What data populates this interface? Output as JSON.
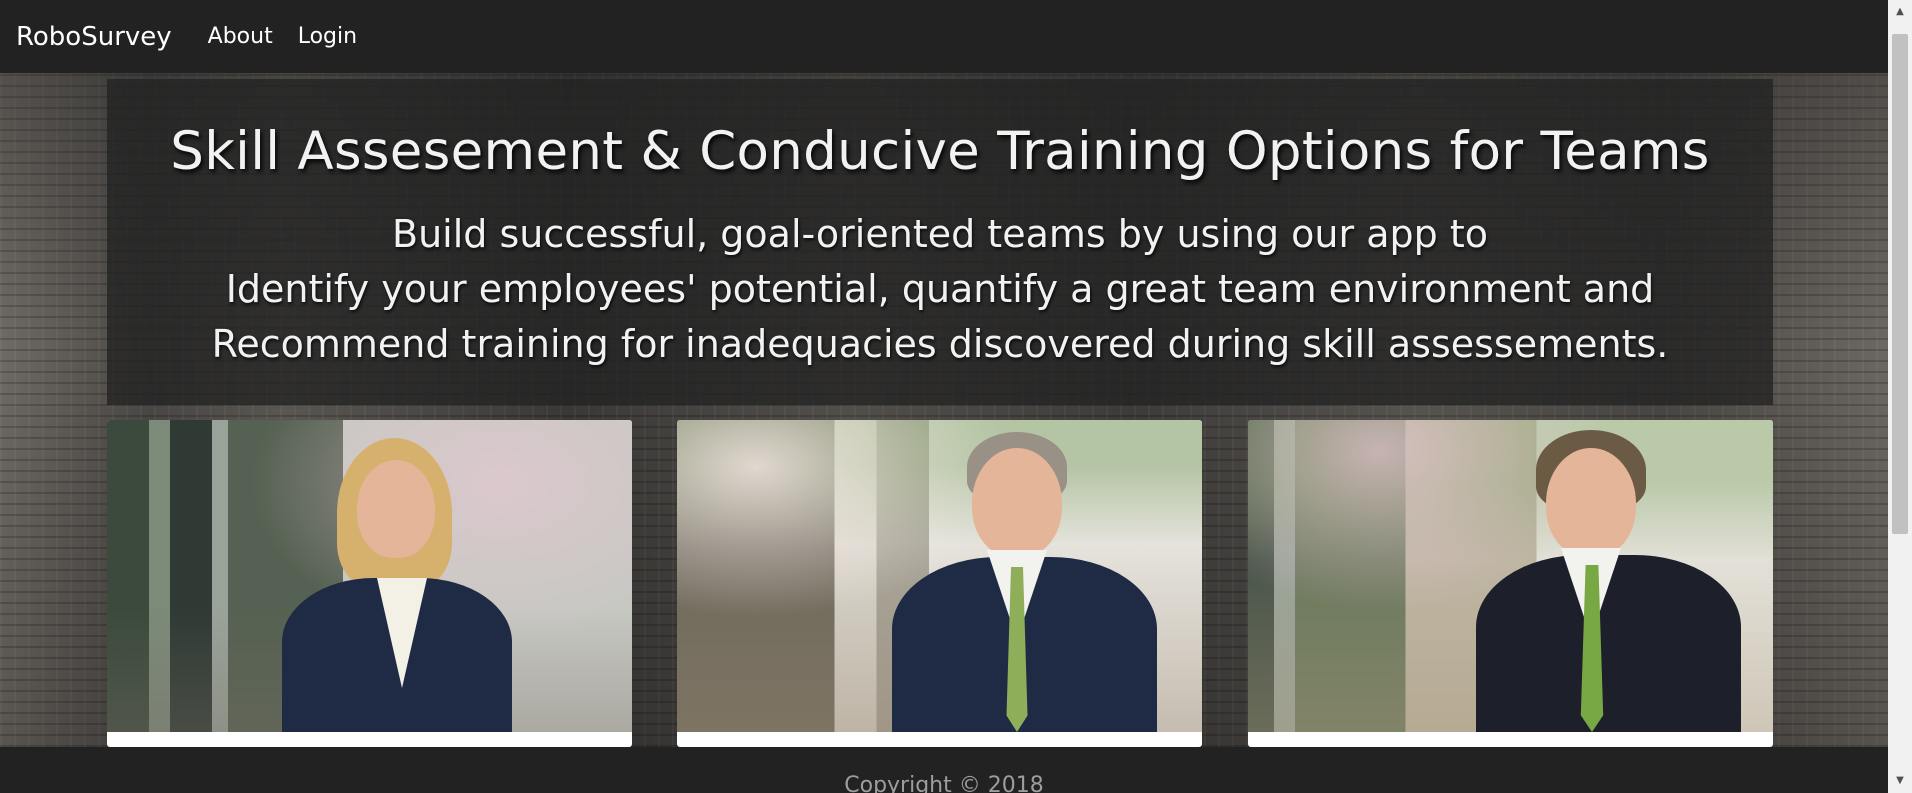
{
  "navbar": {
    "brand": "RoboSurvey",
    "links": [
      {
        "label": "About"
      },
      {
        "label": "Login"
      }
    ]
  },
  "hero": {
    "title": "Skill Assesement & Conducive Training Options for Teams",
    "lead_lines": [
      "Build successful, goal-oriented teams by using our app to",
      "Identify your employees' potential, quantify a great team environment and",
      "Recommend training for inadequacies discovered during skill assessements."
    ]
  },
  "cards": [
    {
      "image": "team-member-photo-woman"
    },
    {
      "image": "team-member-photo-man"
    },
    {
      "image": "team-member-photo-man"
    }
  ],
  "footer": {
    "copyright": "Copyright © 2018"
  },
  "colors": {
    "navbar_bg": "#222222",
    "panel_bg": "rgba(35,35,35,0.78)",
    "text_light": "#ffffff",
    "footer_text": "#9d9d9d"
  }
}
